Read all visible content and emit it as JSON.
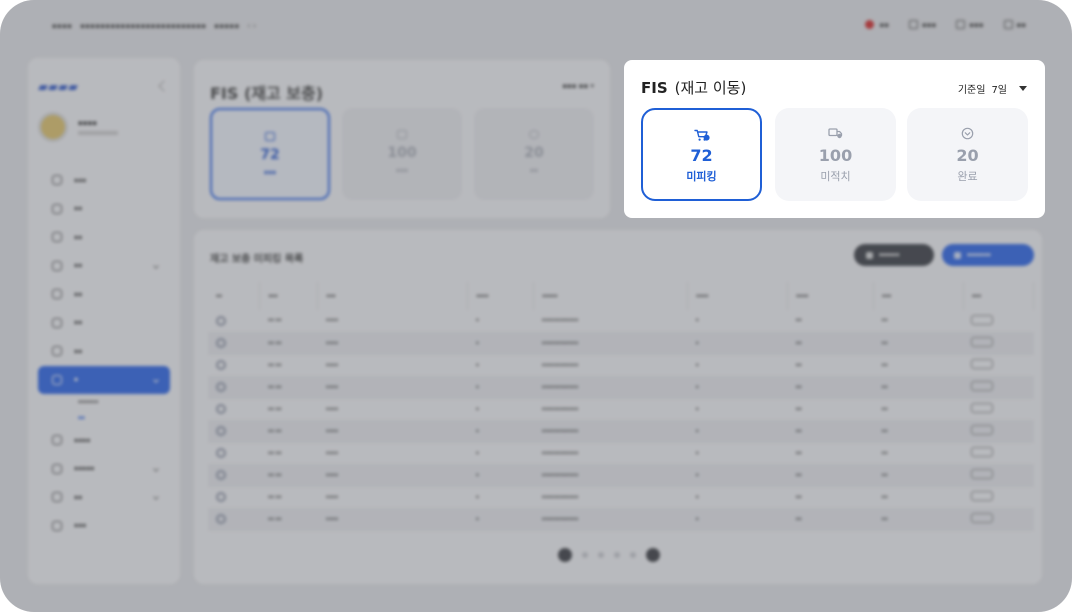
{
  "fis_card": {
    "title_bold": "FIS",
    "title_sub": "(재고 이동)",
    "filter_label": "기준일",
    "filter_value": "7일",
    "tiles": [
      {
        "value": "72",
        "label": "미피킹",
        "icon": "cart-icon",
        "selected": true
      },
      {
        "value": "100",
        "label": "미적치",
        "icon": "truck-icon",
        "selected": false
      },
      {
        "value": "20",
        "label": "완료",
        "icon": "check-circle-icon",
        "selected": false
      }
    ]
  },
  "background": {
    "card_title": "FIS (재고 보충)",
    "tiles": [
      {
        "value": "72"
      },
      {
        "value": "100"
      },
      {
        "value": "20"
      }
    ],
    "table_title": "재고 보충 미피킹 목록"
  },
  "colors": {
    "accent": "#1f5fd6",
    "muted": "#9aa0ad",
    "tile_bg": "#f4f5f8"
  }
}
